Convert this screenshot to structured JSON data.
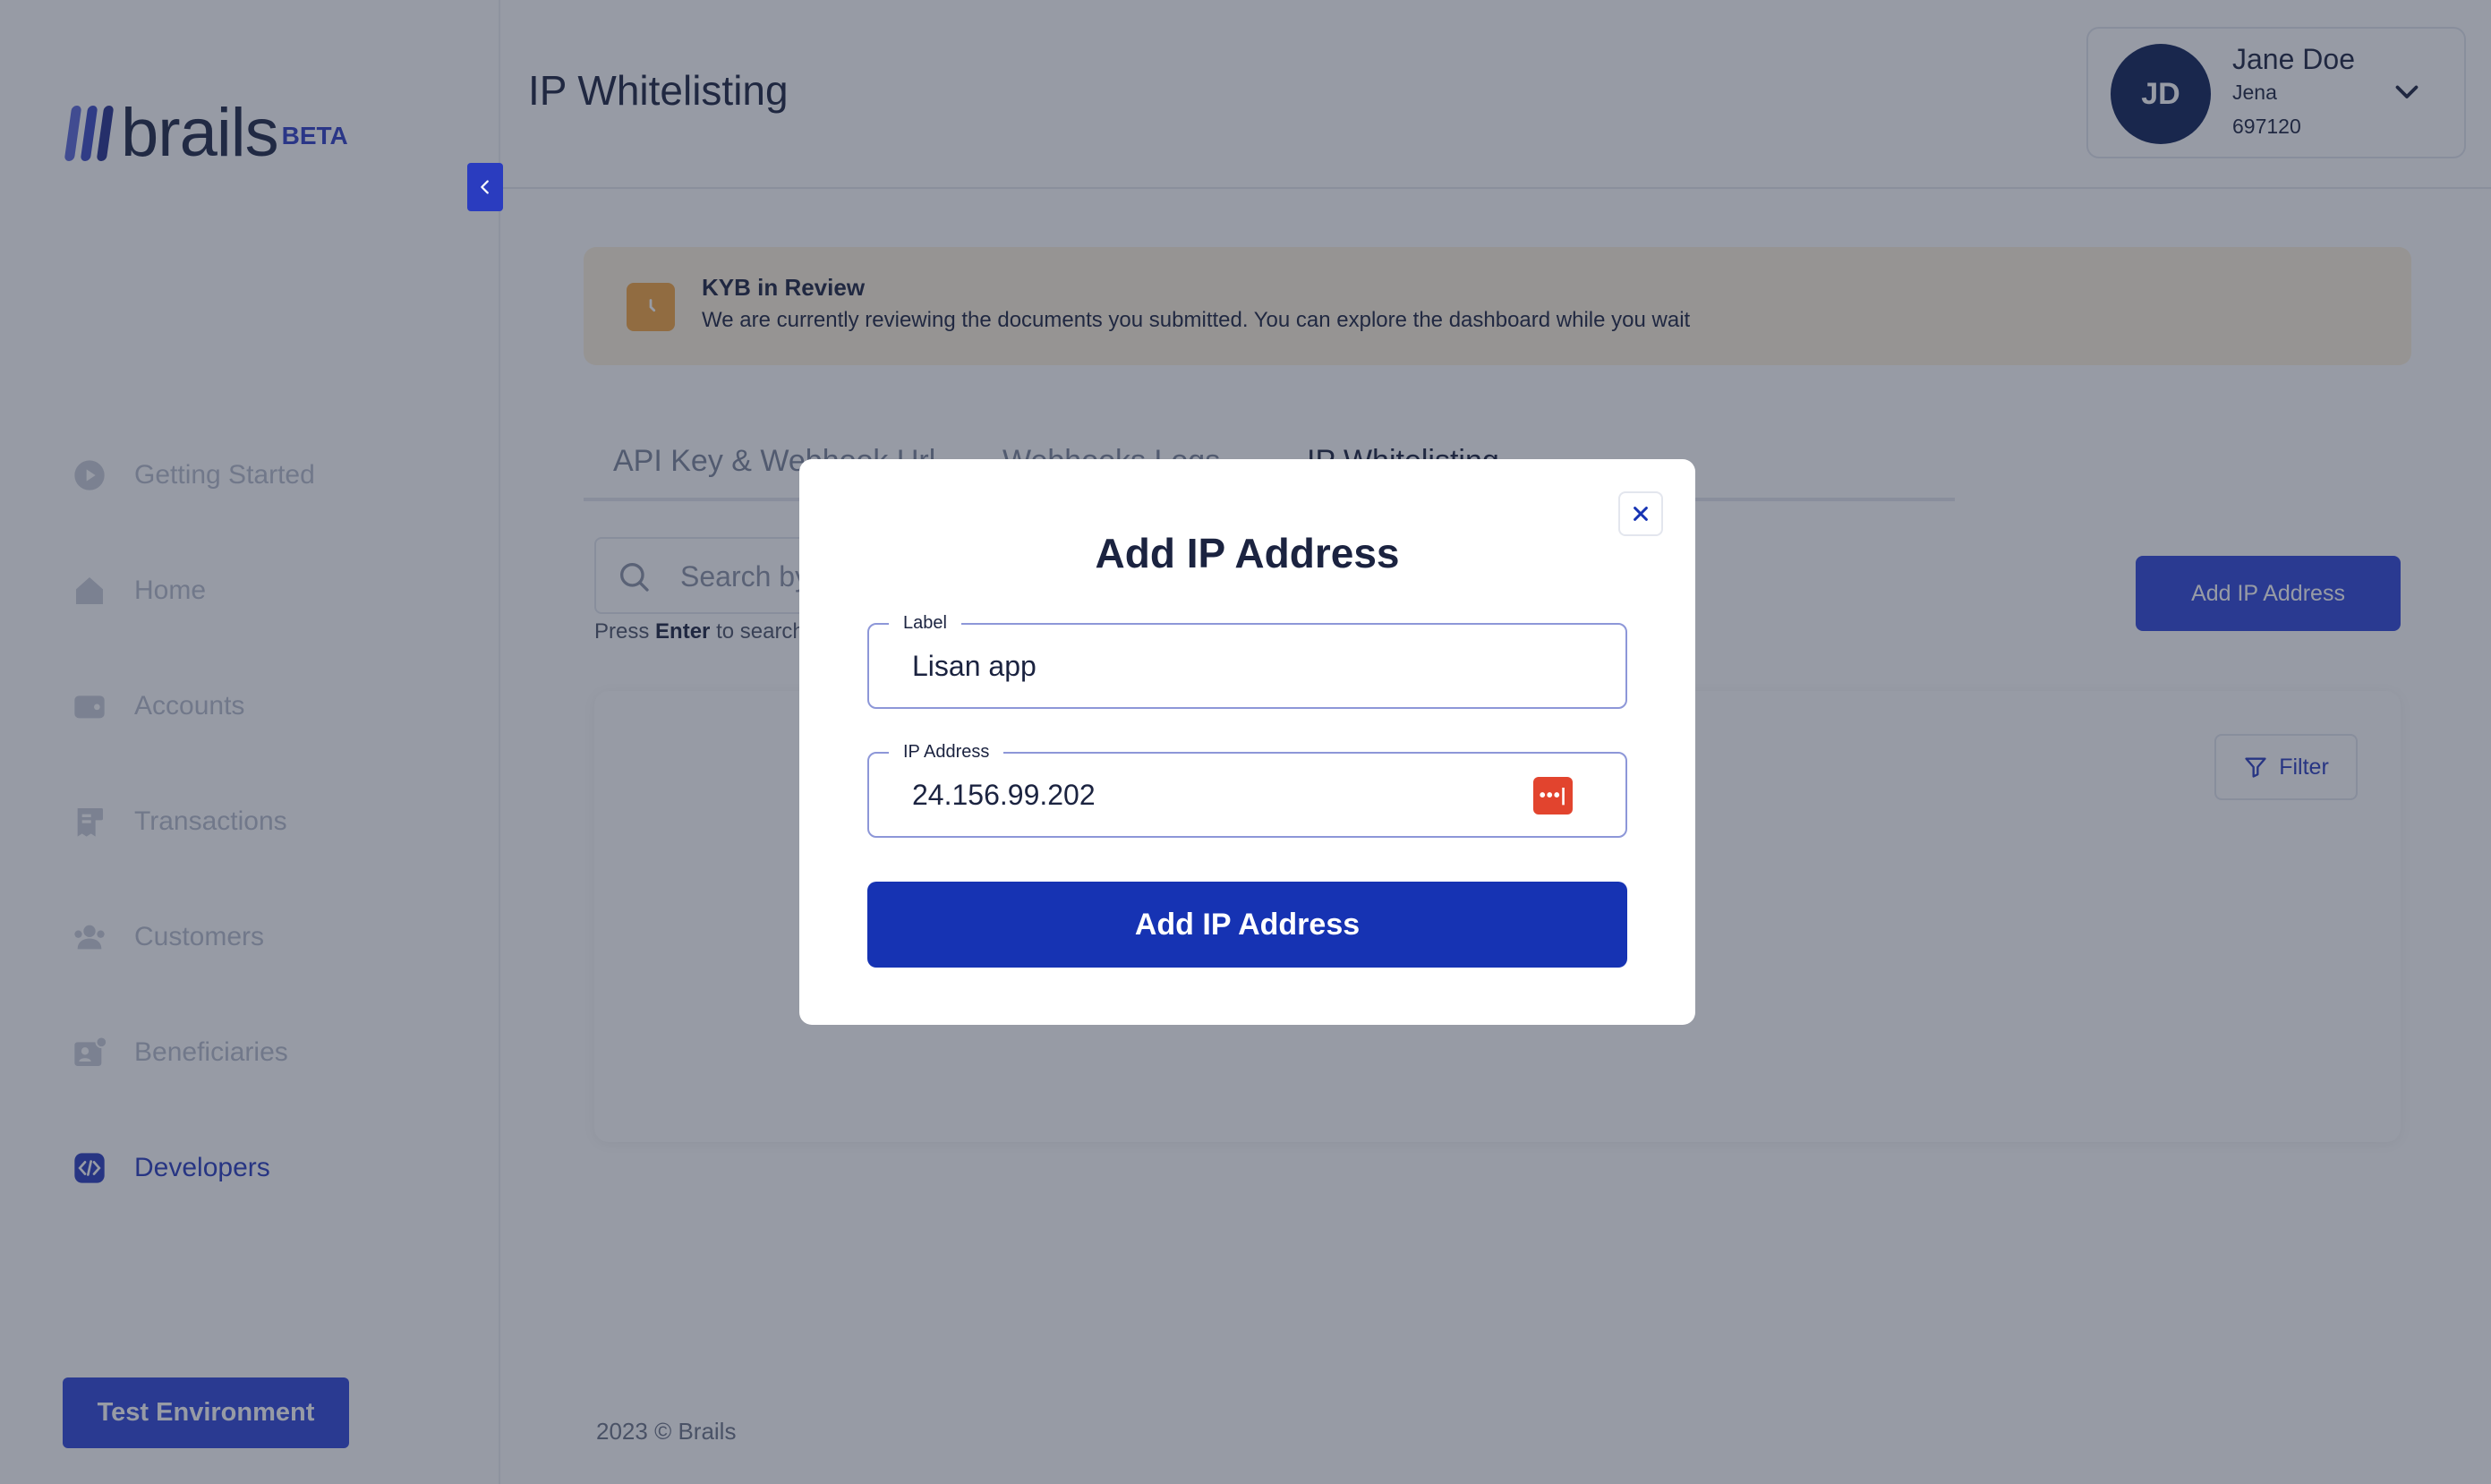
{
  "brand": {
    "name": "brails",
    "badge": "BETA"
  },
  "sidebar": {
    "items": [
      {
        "label": "Getting Started",
        "icon": "play-circle-icon"
      },
      {
        "label": "Home",
        "icon": "home-icon"
      },
      {
        "label": "Accounts",
        "icon": "wallet-icon"
      },
      {
        "label": "Transactions",
        "icon": "receipt-icon"
      },
      {
        "label": "Customers",
        "icon": "users-icon"
      },
      {
        "label": "Beneficiaries",
        "icon": "user-card-icon"
      },
      {
        "label": "Developers",
        "icon": "code-icon",
        "active": true
      }
    ],
    "test_env_label": "Test Environment"
  },
  "header": {
    "title": "IP Whitelisting",
    "user": {
      "initials": "JD",
      "name": "Jane Doe",
      "business": "Jena",
      "id": "697120"
    }
  },
  "kyb": {
    "title": "KYB in Review",
    "message": "We are currently reviewing the documents you submitted. You can explore the dashboard while you wait"
  },
  "tabs": [
    {
      "label": "API Key & Webhook Url"
    },
    {
      "label": "Webhooks Logs"
    },
    {
      "label": "IP Whitelisting",
      "active": true
    }
  ],
  "search": {
    "placeholder": "Search by label",
    "hint_prefix": "Press",
    "hint_key": "Enter",
    "hint_suffix": "to search"
  },
  "add_button_label": "Add IP Address",
  "filter_label": "Filter",
  "footer": "2023 © Brails",
  "modal": {
    "title": "Add IP Address",
    "label_field": {
      "label": "Label",
      "value": "Lisan app"
    },
    "ip_field": {
      "label": "IP Address",
      "value": "24.156.99.202"
    },
    "submit_label": "Add IP Address"
  },
  "colors": {
    "primary": "#2f45d9",
    "navy": "#0f2157",
    "warning_bg": "#fdf1dc",
    "warning_icon": "#f4a540"
  }
}
